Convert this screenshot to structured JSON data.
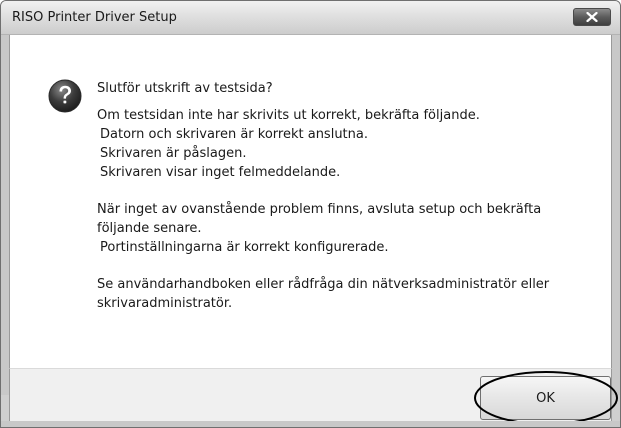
{
  "window": {
    "title": "RISO Printer Driver Setup",
    "close_icon": "close-icon"
  },
  "dialog": {
    "icon": "question-icon",
    "question": "Slutför utskrift av testsida?",
    "lines_group1": [
      "Om testsidan inte har skrivits ut korrekt, bekräfta följande.",
      " Datorn och skrivaren är korrekt anslutna.",
      " Skrivaren är påslagen.",
      " Skrivaren visar inget felmeddelande."
    ],
    "lines_group2": [
      "När inget av ovanstående problem finns, avsluta setup och bekräfta",
      "följande senare.",
      " Portinställningarna är korrekt konfigurerade."
    ],
    "lines_group3": [
      "Se användarhandboken eller rådfråga din nätverksadministratör eller",
      "skrivaradministratör."
    ],
    "ok_label": "OK"
  }
}
